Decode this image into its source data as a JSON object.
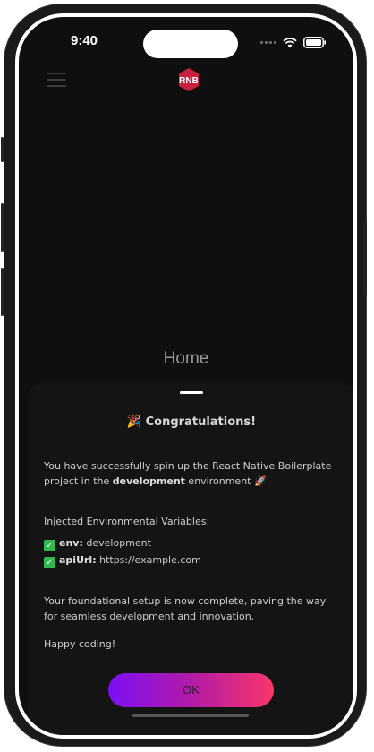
{
  "status_bar": {
    "time": "9:40",
    "icons": [
      "signal-icon",
      "wifi-icon",
      "battery-icon"
    ]
  },
  "header": {
    "menu_icon": "hamburger-icon",
    "logo_text": "RNB"
  },
  "page": {
    "title": "Home"
  },
  "modal": {
    "title_emoji": "🎉",
    "title": "Congratulations!",
    "intro_1": "You have successfully spin up the React Native Boilerplate project in the ",
    "intro_env": "development",
    "intro_2": " environment 🚀",
    "vars_heading": "Injected Environmental Variables:",
    "vars": [
      {
        "key": "env:",
        "value": "development"
      },
      {
        "key": "apiUrl:",
        "value": "https://example.com"
      }
    ],
    "foundation_text": "Your foundational setup is now complete, paving the way for seamless development and innovation.",
    "closing": "Happy coding!",
    "ok_label": "OK"
  },
  "colors": {
    "background": "#0f0f0f",
    "sheet": "#141414",
    "button_gradient_start": "#7c10f3",
    "button_gradient_end": "#f8376a",
    "check_green": "#32b84f",
    "logo_red": "#c8203f"
  }
}
